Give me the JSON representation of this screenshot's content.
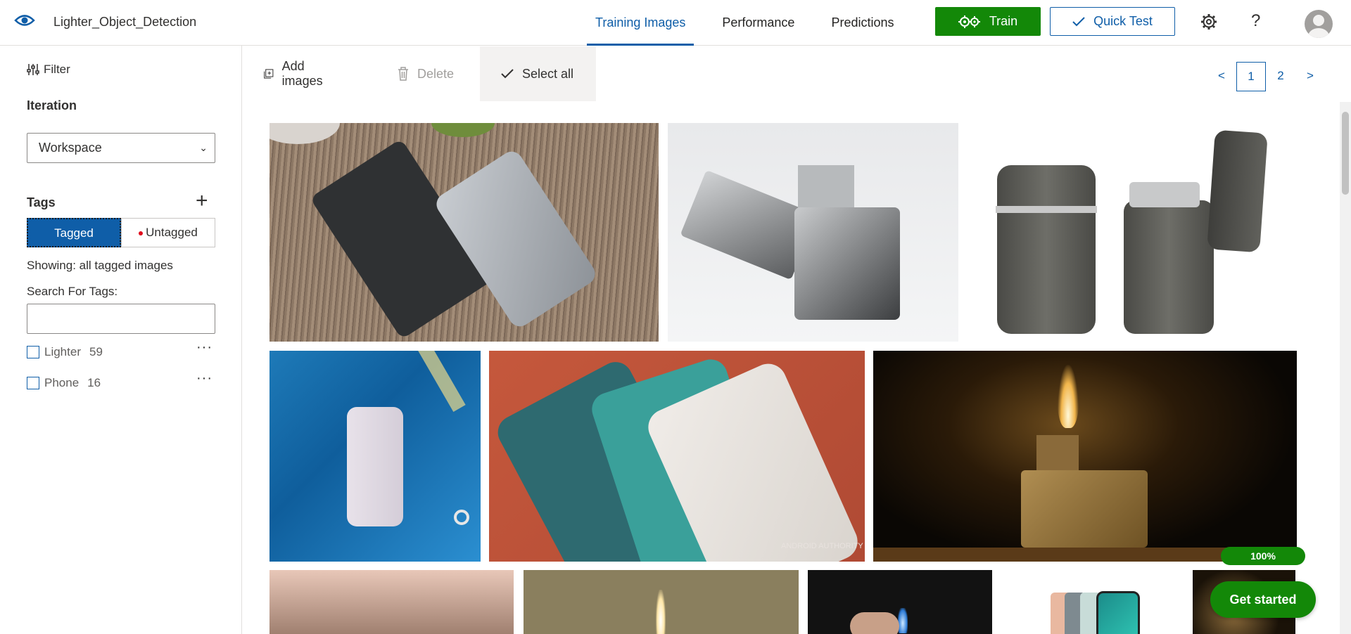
{
  "header": {
    "project_name": "Lighter_Object_Detection",
    "nav": [
      {
        "label": "Training Images",
        "active": true
      },
      {
        "label": "Performance",
        "active": false
      },
      {
        "label": "Predictions",
        "active": false
      }
    ],
    "train_label": "Train",
    "quick_test_label": "Quick Test",
    "help_label": "?"
  },
  "sidebar": {
    "filter_label": "Filter",
    "iteration_label": "Iteration",
    "iteration_value": "Workspace",
    "tags_label": "Tags",
    "toggle": {
      "tagged": "Tagged",
      "untagged": "Untagged"
    },
    "showing_text": "Showing: all tagged images",
    "search_label": "Search For Tags:",
    "search_value": "",
    "tags": [
      {
        "name": "Lighter",
        "count": "59"
      },
      {
        "name": "Phone",
        "count": "16"
      }
    ]
  },
  "toolbar": {
    "add_images": "Add images",
    "delete": "Delete",
    "select_all": "Select all"
  },
  "pager": {
    "prev": "<",
    "pages": [
      "1",
      "2"
    ],
    "current": "1",
    "next": ">"
  },
  "gallery": {
    "images": [
      {
        "subject": "phones on wooden table"
      },
      {
        "subject": "engraved zippo lighter"
      },
      {
        "subject": "grey lighters"
      },
      {
        "subject": "white phone on blue paint"
      },
      {
        "subject": "green and white phones"
      },
      {
        "subject": "lit lighter flame"
      },
      {
        "subject": "hand with lighter"
      },
      {
        "subject": "candle flame"
      },
      {
        "subject": "blue torch lighter"
      },
      {
        "subject": "colorful phones"
      },
      {
        "subject": "dark lighter"
      }
    ],
    "watermark": "ANDROID AUTHORITY"
  },
  "progress": "100%",
  "get_started_label": "Get started",
  "colors": {
    "accent": "#0f5ea8",
    "green": "#138808"
  }
}
